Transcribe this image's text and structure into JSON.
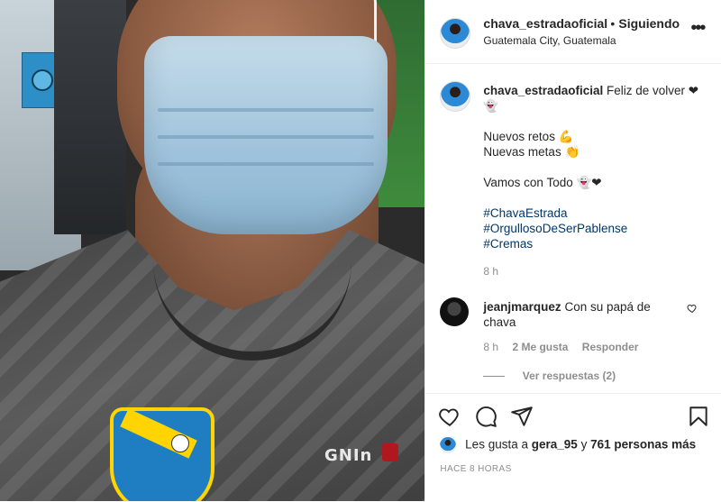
{
  "post": {
    "photo_alt": "",
    "brand_text": "GNIn"
  },
  "header": {
    "username": "chava_estradaoficial",
    "separator": "•",
    "follow_status": "Siguiendo",
    "location": "Guatemala City, Guatemala",
    "more_icon": "ellipsis-icon"
  },
  "caption": {
    "username": "chava_estradaoficial",
    "lines": [
      "Feliz de volver ❤👻",
      "",
      "Nuevos retos 💪",
      "Nuevas metas 👏",
      "",
      "Vamos con Todo 👻❤",
      ""
    ],
    "hashtags": [
      "#ChavaEstrada",
      "#OrgullosoDeSerPablense",
      "#Cremas"
    ],
    "time": "8 h"
  },
  "comment": {
    "username": "jeanjmarquez",
    "text": "Con su papá de chava",
    "time": "8 h",
    "likes": "2 Me gusta",
    "reply": "Responder",
    "view_replies": "Ver respuestas (2)"
  },
  "actions": {
    "like_icon": "heart-icon",
    "comment_icon": "comment-icon",
    "share_icon": "send-icon",
    "save_icon": "bookmark-icon"
  },
  "likes": {
    "prefix": "Les gusta a",
    "user": "gera_95",
    "connector": "y",
    "others": "761 personas más"
  },
  "posted_ago": "HACE 8 HORAS"
}
